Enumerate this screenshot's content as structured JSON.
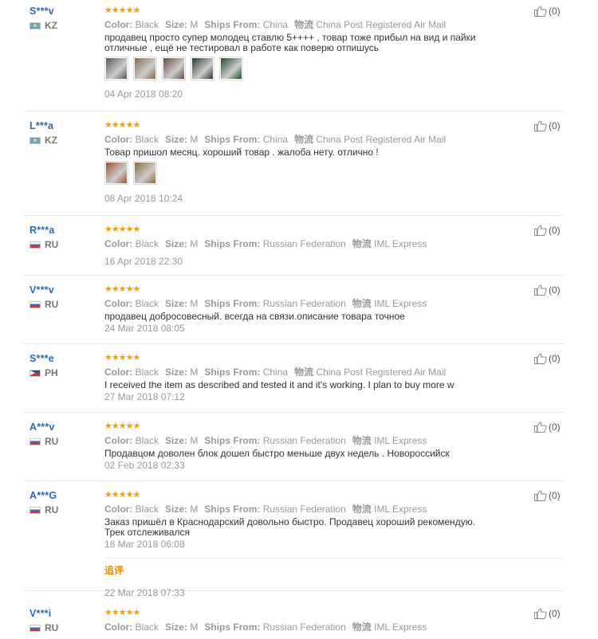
{
  "labels": {
    "color": "Color:",
    "size": "Size:",
    "ships_from": "Ships From:",
    "shipping": "物流"
  },
  "reviews": [
    {
      "user": "S***v",
      "country_code": "KZ",
      "flag": "kz",
      "stars": "★★★★★",
      "color": "Black",
      "size": "M",
      "ships_from": "China",
      "shipping": "China Post Registered Air Mail",
      "text": "продавец просто супер молодец ставлю 5++++ , товар тоже прибыл на вид и пайки отличные , ещё не тестировал в работе как поверю отпишусь",
      "photos": [
        "#5a5a5a",
        "#8a6a4a",
        "#6a4a3a",
        "#2a3a2a",
        "#1f4f2a"
      ],
      "date": "04 Apr 2018 08:20",
      "helpful": "(0)"
    },
    {
      "user": "L***a",
      "country_code": "KZ",
      "flag": "kz",
      "stars": "★★★★★",
      "color": "Black",
      "size": "M",
      "ships_from": "China",
      "shipping": "China Post Registered Air Mail",
      "text": "Товар пришол месяц. хороший товар . жалоба нету. отлично !",
      "photos": [
        "#a0522d",
        "#8b6b3a"
      ],
      "date": "08 Apr 2018 10:24",
      "helpful": "(0)"
    },
    {
      "user": "R***a",
      "country_code": "RU",
      "flag": "ru",
      "stars": "★★★★★",
      "color": "Black",
      "size": "M",
      "ships_from": "Russian Federation",
      "shipping": "IML Express",
      "text": "",
      "photos": [],
      "date": "16 Apr 2018 22:30",
      "helpful": "(0)"
    },
    {
      "user": "V***v",
      "country_code": "RU",
      "flag": "ru",
      "stars": "★★★★★",
      "color": "Black",
      "size": "M",
      "ships_from": "Russian Federation",
      "shipping": "IML Express",
      "text": "продавец добросовесный. всегда на связи.описание товара точное",
      "photos": [],
      "date": "24 Mar 2018 08:05",
      "helpful": "(0)"
    },
    {
      "user": "S***e",
      "country_code": "PH",
      "flag": "ph",
      "stars": "★★★★★",
      "color": "Black",
      "size": "M",
      "ships_from": "China",
      "shipping": "China Post Registered Air Mail",
      "text": "I received the item as described and tested it and it's working. I plan to buy more w",
      "photos": [],
      "date": "27 Mar 2018 07:12",
      "helpful": "(0)"
    },
    {
      "user": "A***v",
      "country_code": "RU",
      "flag": "ru",
      "stars": "★★★★★",
      "color": "Black",
      "size": "M",
      "ships_from": "Russian Federation",
      "shipping": "IML Express",
      "text": "Продавцом доволен блок дошел быстро меньше двух недель . Новороссийск",
      "photos": [],
      "date": "02 Feb 2018 02:33",
      "helpful": "(0)"
    },
    {
      "user": "A***G",
      "country_code": "RU",
      "flag": "ru",
      "stars": "★★★★★",
      "color": "Black",
      "size": "M",
      "ships_from": "Russian Federation",
      "shipping": "IML Express",
      "text": "Заказ пришёл в Краснодарский довольно быстро. Продавец хороший рекомендую. Трек отслеживался",
      "photos": [],
      "date": "18 Mar 2018 06:08",
      "additional_label": "追评",
      "additional_date": "22 Mar 2018 07:33",
      "helpful": "(0)"
    },
    {
      "user": "V***i",
      "country_code": "RU",
      "flag": "ru",
      "stars": "★★★★★",
      "color": "Black",
      "size": "M",
      "ships_from": "Russian Federation",
      "shipping": "IML Express",
      "text": "",
      "photos": [],
      "date": "",
      "helpful": "(0)"
    }
  ]
}
